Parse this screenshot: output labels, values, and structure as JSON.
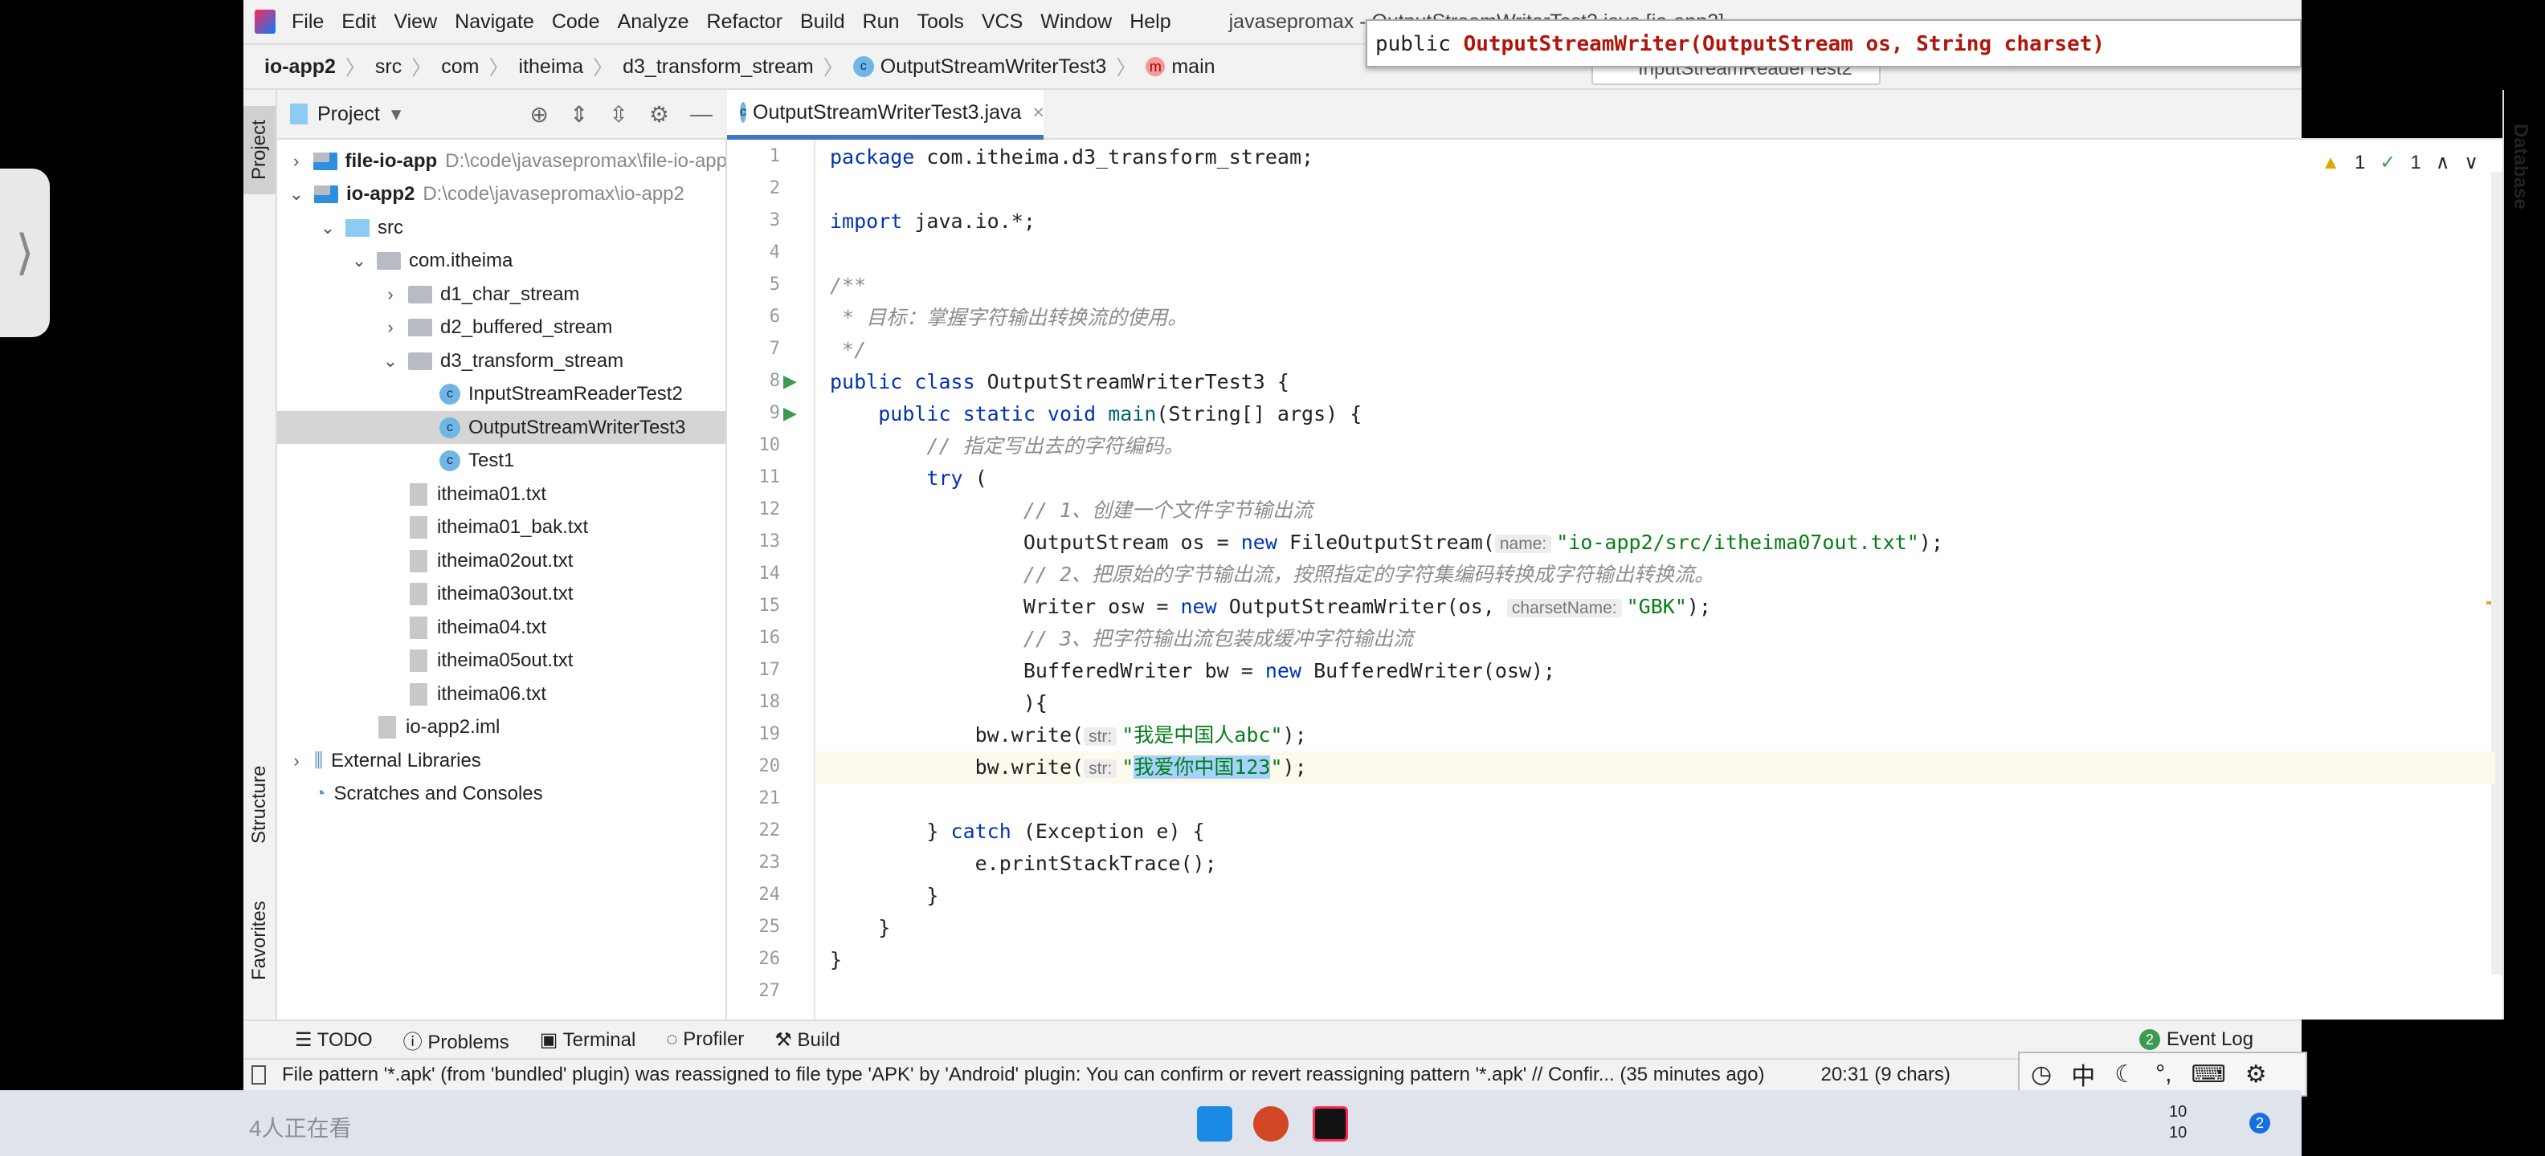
{
  "menu": {
    "items": [
      "File",
      "Edit",
      "View",
      "Navigate",
      "Code",
      "Analyze",
      "Refactor",
      "Build",
      "Run",
      "Tools",
      "VCS",
      "Window",
      "Help"
    ],
    "title": "javasepromax - OutputStreamWriterTest3.java [io-app2]"
  },
  "breadcrumb": [
    "io-app2",
    "src",
    "com",
    "itheima",
    "d3_transform_stream",
    "OutputStreamWriterTest3",
    "main"
  ],
  "run_config": "InputStreamReaderTest2",
  "tooltip": {
    "prefix": "public",
    "signature": "OutputStreamWriter(OutputStream os, String charset)"
  },
  "left_strip": {
    "project": "Project",
    "structure": "Structure",
    "favorites": "Favorites"
  },
  "project_panel": {
    "title": "Project"
  },
  "tree": [
    {
      "label": "file-io-app",
      "path": "D:\\code\\javasepromax\\file-io-app",
      "indent": 0,
      "chev": ">",
      "icon": "module",
      "bold": true
    },
    {
      "label": "io-app2",
      "path": "D:\\code\\javasepromax\\io-app2",
      "indent": 0,
      "chev": "v",
      "icon": "module",
      "bold": true
    },
    {
      "label": "src",
      "indent": 1,
      "chev": "v",
      "icon": "src"
    },
    {
      "label": "com.itheima",
      "indent": 2,
      "chev": "v",
      "icon": "folder"
    },
    {
      "label": "d1_char_stream",
      "indent": 3,
      "chev": ">",
      "icon": "folder"
    },
    {
      "label": "d2_buffered_stream",
      "indent": 3,
      "chev": ">",
      "icon": "folder"
    },
    {
      "label": "d3_transform_stream",
      "indent": 3,
      "chev": "v",
      "icon": "folder"
    },
    {
      "label": "InputStreamReaderTest2",
      "indent": 4,
      "icon": "class"
    },
    {
      "label": "OutputStreamWriterTest3",
      "indent": 4,
      "icon": "class",
      "selected": true
    },
    {
      "label": "Test1",
      "indent": 4,
      "icon": "class"
    },
    {
      "label": "itheima01.txt",
      "indent": 3,
      "icon": "txt"
    },
    {
      "label": "itheima01_bak.txt",
      "indent": 3,
      "icon": "txt"
    },
    {
      "label": "itheima02out.txt",
      "indent": 3,
      "icon": "txt"
    },
    {
      "label": "itheima03out.txt",
      "indent": 3,
      "icon": "txt"
    },
    {
      "label": "itheima04.txt",
      "indent": 3,
      "icon": "txt"
    },
    {
      "label": "itheima05out.txt",
      "indent": 3,
      "icon": "txt"
    },
    {
      "label": "itheima06.txt",
      "indent": 3,
      "icon": "txt"
    },
    {
      "label": "io-app2.iml",
      "indent": 2,
      "icon": "txt"
    },
    {
      "label": "External Libraries",
      "indent": 0,
      "chev": ">",
      "icon": "lib"
    },
    {
      "label": "Scratches and Consoles",
      "indent": 0,
      "icon": "scratch"
    }
  ],
  "editor": {
    "tab": "OutputStreamWriterTest3.java",
    "warnings": "1",
    "weak_warnings": "1",
    "lines": [
      [
        [
          "kw",
          "package"
        ],
        [
          "p",
          " com.itheima.d3_transform_stream;"
        ]
      ],
      [],
      [
        [
          "kw",
          "import"
        ],
        [
          "p",
          " java.io.*;"
        ]
      ],
      [],
      [
        [
          "cm",
          "/**"
        ]
      ],
      [
        [
          "cm",
          " * 目标：掌握字符输出转换流的使用。"
        ]
      ],
      [
        [
          "cm",
          " */"
        ]
      ],
      [
        [
          "kw",
          "public class"
        ],
        [
          "p",
          " OutputStreamWriterTest3 {"
        ]
      ],
      [
        [
          "p",
          "    "
        ],
        [
          "kw",
          "public static void"
        ],
        [
          "mt",
          " main"
        ],
        [
          "p",
          "(String[] args) {"
        ]
      ],
      [
        [
          "cm",
          "        // 指定写出去的字符编码。"
        ]
      ],
      [
        [
          "p",
          "        "
        ],
        [
          "kw",
          "try"
        ],
        [
          "p",
          " ("
        ]
      ],
      [
        [
          "cm",
          "                // 1、创建一个文件字节输出流"
        ]
      ],
      [
        [
          "p",
          "                OutputStream os = "
        ],
        [
          "kw",
          "new"
        ],
        [
          "p",
          " FileOutputStream("
        ],
        [
          "h",
          "name:"
        ],
        [
          "st",
          "\"io-app2/src/itheima07out.txt\""
        ],
        [
          "p",
          ");"
        ]
      ],
      [
        [
          "cm",
          "                // 2、把原始的字节输出流，按照指定的字符集编码转换成字符输出转换流。"
        ]
      ],
      [
        [
          "p",
          "                Writer osw = "
        ],
        [
          "kw",
          "new"
        ],
        [
          "p",
          " OutputStreamWriter(os, "
        ],
        [
          "h",
          "charsetName:"
        ],
        [
          "st",
          "\"GBK\""
        ],
        [
          "p",
          ");"
        ]
      ],
      [
        [
          "cm",
          "                // 3、把字符输出流包装成缓冲字符输出流"
        ]
      ],
      [
        [
          "p",
          "                BufferedWriter bw = "
        ],
        [
          "kw",
          "new"
        ],
        [
          "p",
          " BufferedWriter(osw);"
        ]
      ],
      [
        [
          "p",
          "                ){"
        ]
      ],
      [
        [
          "p",
          "            bw.write("
        ],
        [
          "h",
          "str:"
        ],
        [
          "st",
          "\"我是中国人abc\""
        ],
        [
          "p",
          ");"
        ]
      ],
      [
        [
          "p",
          "            bw.write("
        ],
        [
          "h",
          "str:"
        ],
        [
          "st",
          "\""
        ],
        [
          "sel",
          "我爱你中国123"
        ],
        [
          "st",
          "\""
        ],
        [
          "p",
          ");"
        ]
      ],
      [],
      [
        [
          "p",
          "        } "
        ],
        [
          "kw",
          "catch"
        ],
        [
          "p",
          " (Exception e) {"
        ]
      ],
      [
        [
          "p",
          "            e.printStackTrace();"
        ]
      ],
      [
        [
          "p",
          "        }"
        ]
      ],
      [
        [
          "p",
          "    }"
        ]
      ],
      [
        [
          "p",
          "}"
        ]
      ],
      []
    ],
    "run_markers": [
      8,
      9
    ],
    "current_line": 20
  },
  "right_strip": {
    "database": "Database"
  },
  "bottom_tools": [
    "TODO",
    "Problems",
    "Terminal",
    "Profiler",
    "Build"
  ],
  "event_log": {
    "label": "Event Log",
    "count": "2"
  },
  "status": {
    "message": "File pattern '*.apk' (from 'bundled' plugin) was reassigned to file type 'APK' by 'Android' plugin: You can confirm or revert reassigning pattern '*.apk' // Confir... (35 minutes ago)",
    "position": "20:31 (9 chars)"
  },
  "ime": {
    "mode": "中"
  },
  "overlay": {
    "viewers": "4人正在看"
  },
  "taskbar": {
    "clock": "10\n10",
    "notif": "2"
  }
}
